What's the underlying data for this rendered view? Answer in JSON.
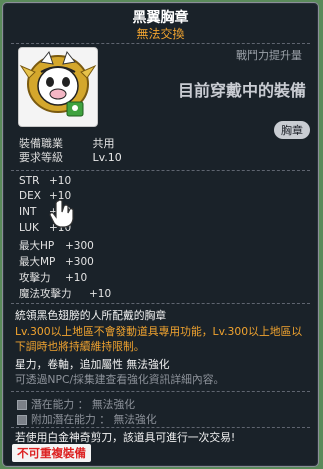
{
  "title": "黑翼胸章",
  "subtitle": "無法交換",
  "combat_label": "戰鬥力提升量",
  "equipped_text": "目前穿戴中的裝備",
  "slot_badge": "胸章",
  "requirements": [
    {
      "label": "裝備職業",
      "value": "共用"
    },
    {
      "label": "要求等級",
      "value": "Lv.10"
    }
  ],
  "stats": [
    {
      "label": "STR",
      "value": "+10"
    },
    {
      "label": "DEX",
      "value": "+10"
    },
    {
      "label": "INT",
      "value": "+10"
    },
    {
      "label": "LUK",
      "value": "+10"
    }
  ],
  "stats2": [
    {
      "label": "最大HP",
      "value": "+300"
    },
    {
      "label": "最大MP",
      "value": "+300"
    },
    {
      "label": "攻擊力",
      "value": "+10"
    },
    {
      "label": "魔法攻擊力",
      "value": "+10"
    }
  ],
  "description": "統領黑色翅膀的人所配戴的胸章",
  "note_orange": "Lv.300以上地區不會發動道具專用功能，Lv.300以上地區以下調時也將持續維持限制。",
  "enhance_line": "星力，卷軸，追加屬性 無法強化",
  "enhance_grey": "可透過NPC/採集建查看強化資訊詳細內容。",
  "potential": "潛在能力 ： 無法強化",
  "bonus_potential": "附加潛在能力 ： 無法強化",
  "scissors_text": "若使用白金神奇剪刀，該道具可進行一次交易!",
  "no_trade_badge": "不可重複裝備",
  "colors": {
    "accent": "#f0a32f",
    "danger": "#d22222"
  }
}
